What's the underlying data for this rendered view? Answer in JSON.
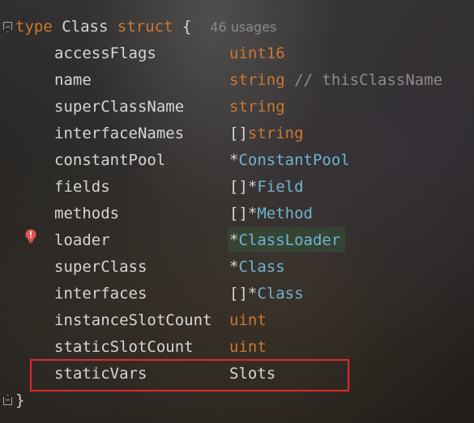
{
  "editor": {
    "header": {
      "keyword_type": "type",
      "name": "Class",
      "keyword_struct": "struct",
      "brace_open": "{",
      "usages_hint": "46 usages"
    },
    "fields": [
      {
        "name": "accessFlags",
        "type_parts": [
          {
            "text": "uint16",
            "kind": "kw"
          }
        ]
      },
      {
        "name": "name",
        "type_parts": [
          {
            "text": "string",
            "kind": "kw"
          },
          {
            "text": " // thisClassName",
            "kind": "comment"
          }
        ]
      },
      {
        "name": "superClassName",
        "type_parts": [
          {
            "text": "string",
            "kind": "kw"
          }
        ]
      },
      {
        "name": "interfaceNames",
        "type_parts": [
          {
            "text": "[]",
            "kind": "op"
          },
          {
            "text": "string",
            "kind": "kw"
          }
        ]
      },
      {
        "name": "constantPool",
        "type_parts": [
          {
            "text": "*",
            "kind": "op"
          },
          {
            "text": "ConstantPool",
            "kind": "ref"
          }
        ]
      },
      {
        "name": "fields",
        "type_parts": [
          {
            "text": "[]*",
            "kind": "op"
          },
          {
            "text": "Field",
            "kind": "ref"
          }
        ]
      },
      {
        "name": "methods",
        "type_parts": [
          {
            "text": "[]*",
            "kind": "op"
          },
          {
            "text": "Method",
            "kind": "ref"
          }
        ]
      },
      {
        "name": "loader",
        "type_parts": [
          {
            "text": "*",
            "kind": "op"
          },
          {
            "text": "ClassLoader",
            "kind": "ref"
          }
        ]
      },
      {
        "name": "superClass",
        "type_parts": [
          {
            "text": "*",
            "kind": "op"
          },
          {
            "text": "Class",
            "kind": "ref"
          }
        ]
      },
      {
        "name": "interfaces",
        "type_parts": [
          {
            "text": "[]*",
            "kind": "op"
          },
          {
            "text": "Class",
            "kind": "ref"
          }
        ]
      },
      {
        "name": "instanceSlotCount",
        "type_parts": [
          {
            "text": "uint",
            "kind": "kw"
          }
        ]
      },
      {
        "name": "staticSlotCount",
        "type_parts": [
          {
            "text": "uint",
            "kind": "kw"
          }
        ]
      },
      {
        "name": "staticVars",
        "type_parts": [
          {
            "text": "Slots",
            "kind": "plain"
          }
        ]
      }
    ],
    "brace_close": "}",
    "colors": {
      "keyword": "#cc7832",
      "type_ref": "#6fb3d2",
      "text": "#d6d6d6",
      "comment": "#8c8c8c",
      "highlight_box": "#e02a2a",
      "bulb": "#e05555"
    },
    "icons": {
      "gutter_bulb": "intention-bulb-icon",
      "fold_start": "fold-start-icon",
      "fold_end": "fold-end-icon"
    }
  }
}
